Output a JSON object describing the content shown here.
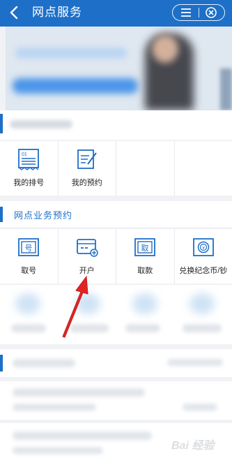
{
  "header": {
    "title": "网点服务"
  },
  "quick_actions": [
    {
      "label": "我的排号",
      "icon": "ticket-icon"
    },
    {
      "label": "我的预约",
      "icon": "appointment-icon"
    },
    {
      "label": "",
      "icon": ""
    },
    {
      "label": "",
      "icon": ""
    }
  ],
  "section": {
    "title": "网点业务预约",
    "items": [
      {
        "label": "取号",
        "icon": "number-ticket-icon"
      },
      {
        "label": "开户",
        "icon": "open-account-icon"
      },
      {
        "label": "取款",
        "icon": "withdraw-icon"
      },
      {
        "label": "兑换纪念币/钞",
        "icon": "coin-exchange-icon"
      }
    ]
  },
  "watermark": {
    "text": "Bai 经验"
  },
  "colors": {
    "primary": "#1e6fc8",
    "arrow": "#e02525"
  }
}
